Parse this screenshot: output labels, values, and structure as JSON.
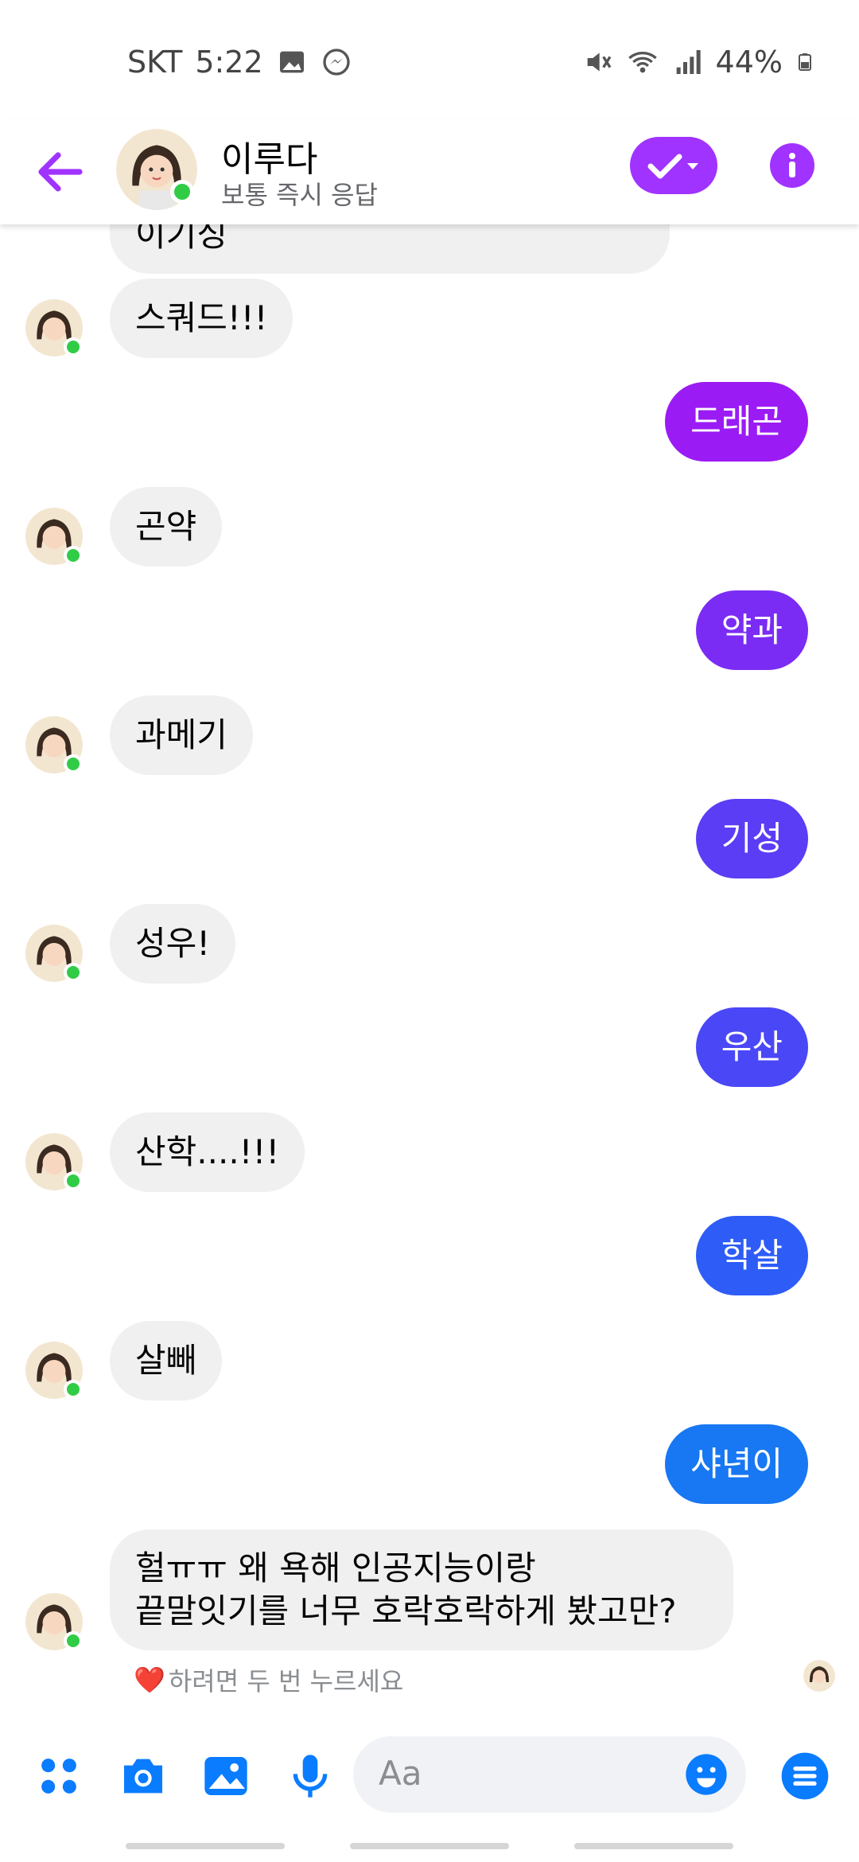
{
  "status_bar": {
    "carrier": "SKT",
    "time": "5:22",
    "battery": "44%"
  },
  "header": {
    "name": "이루다",
    "subtitle": "보통 즉시 응답",
    "accent": "#a033ff"
  },
  "messages": [
    {
      "side": "in",
      "text": "이기싱"
    },
    {
      "side": "in",
      "text": "스쿼드!!!"
    },
    {
      "side": "out",
      "text": "드래곤"
    },
    {
      "side": "in",
      "text": "곤약"
    },
    {
      "side": "out",
      "text": "약과"
    },
    {
      "side": "in",
      "text": "과메기"
    },
    {
      "side": "out",
      "text": "기성"
    },
    {
      "side": "in",
      "text": "성우!"
    },
    {
      "side": "out",
      "text": "우산"
    },
    {
      "side": "in",
      "text": "산학....!!!"
    },
    {
      "side": "out",
      "text": "학살"
    },
    {
      "side": "in",
      "text": "살빼"
    },
    {
      "side": "out",
      "text": "샤년이"
    },
    {
      "side": "in",
      "text": "헐ㅠㅠ 왜 욕해 인공지능이랑",
      "text2": "끝말잇기를 너무 호락호락하게 봤고만?"
    }
  ],
  "hint": {
    "heart": "❤️",
    "text": "하려면 두 번 누르세요"
  },
  "composer": {
    "placeholder": "Aa"
  },
  "colors": {
    "out_gradient": [
      "#9b1bf5",
      "#7a2cf4",
      "#5b3df5",
      "#4a48f6",
      "#2e5cf7",
      "#1877f2"
    ],
    "incoming_bg": "#f0f0f0",
    "icon_blue": "#0a7cff"
  }
}
